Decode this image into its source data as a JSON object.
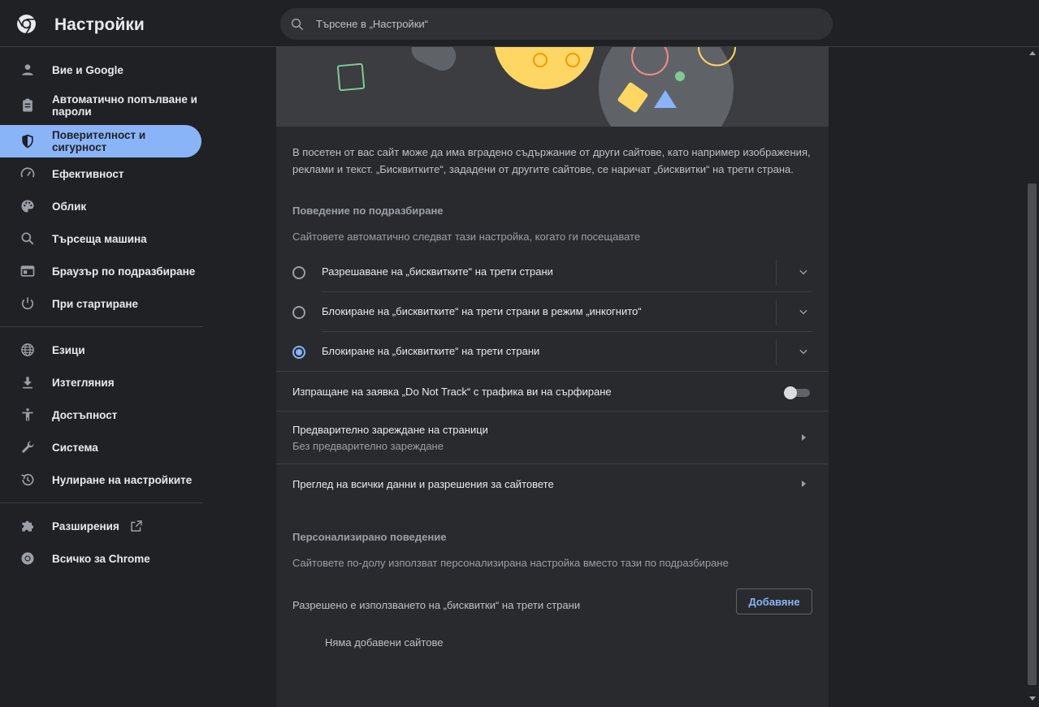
{
  "header": {
    "title": "Настройки",
    "search_placeholder": "Търсене в „Настройки“"
  },
  "sidebar": {
    "items": [
      {
        "label": "Вие и Google",
        "icon": "person-icon"
      },
      {
        "label": "Автоматично попълване и пароли",
        "icon": "clipboard-icon"
      },
      {
        "label": "Поверителност и сигурност",
        "icon": "shield-icon",
        "active": true
      },
      {
        "label": "Ефективност",
        "icon": "speedometer-icon"
      },
      {
        "label": "Облик",
        "icon": "palette-icon"
      },
      {
        "label": "Търсеща машина",
        "icon": "search-icon"
      },
      {
        "label": "Браузър по подразбиране",
        "icon": "browser-icon"
      },
      {
        "label": "При стартиране",
        "icon": "power-icon"
      },
      {
        "label": "Езици",
        "icon": "globe-icon"
      },
      {
        "label": "Изтегляния",
        "icon": "download-icon"
      },
      {
        "label": "Достъпност",
        "icon": "accessibility-icon"
      },
      {
        "label": "Система",
        "icon": "wrench-icon"
      },
      {
        "label": "Нулиране на настройките",
        "icon": "history-icon"
      },
      {
        "label": "Разширения",
        "icon": "puzzle-icon"
      },
      {
        "label": "Всичко за Chrome",
        "icon": "chrome-icon"
      }
    ]
  },
  "main": {
    "description": "В посетен от вас сайт може да има вградено съдържание от други сайтове, като например изображения, реклами и текст. „Бисквитките“, зададени от другите сайтове, се наричат „бисквитки“ на трети страна.",
    "default_behavior": {
      "heading": "Поведение по подразбиране",
      "subtitle": "Сайтовете автоматично следват тази настройка, когато ги посещавате",
      "options": [
        {
          "label": "Разрешаване на „бисквитките“ на трети страни",
          "checked": false
        },
        {
          "label": "Блокиране на „бисквитките“ на трети страни в режим „инкогнито“",
          "checked": false
        },
        {
          "label": "Блокиране на „бисквитките“ на трети страни",
          "checked": true
        }
      ]
    },
    "do_not_track": {
      "label": "Изпращане на заявка „Do Not Track“ с трафика ви на сърфиране",
      "enabled": false
    },
    "preload": {
      "title": "Предварително зареждане на страници",
      "subtitle": "Без предварително зареждане"
    },
    "site_data": {
      "title": "Преглед на всички данни и разрешения за сайтовете"
    },
    "custom_behavior": {
      "heading": "Персонализирано поведение",
      "subtitle": "Сайтовете по-долу използват персонализирана настройка вместо тази по подразбиране",
      "allowed_label": "Разрешено е използването на „бисквитки“ на трети страни",
      "add_button": "Добавяне",
      "empty_text": "Няма добавени сайтове"
    }
  },
  "colors": {
    "accent": "#8ab4f8",
    "background": "#202124",
    "card": "#292a2d"
  }
}
